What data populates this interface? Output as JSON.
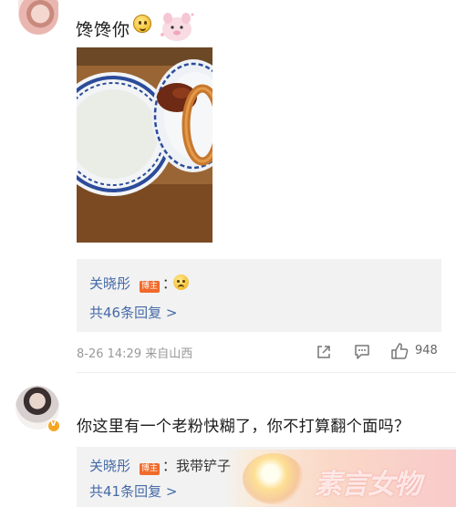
{
  "comment1": {
    "text": "馋馋你",
    "reply_preview": {
      "author": "关晓彤",
      "badge": "博主",
      "separator": "：",
      "emoji": "sad-face-emoji"
    },
    "reply_count_label": "共46条回复 >",
    "meta": "8-26 14:29 来自山西",
    "likes": "948"
  },
  "comment2": {
    "text": "你这里有一个老粉快糊了，你不打算翻个面吗？",
    "reply_preview": {
      "author": "关晓彤",
      "badge": "博主",
      "text": "：我带铲子"
    },
    "reply_count_label": "共41条回复 >"
  },
  "watermark": {
    "text": "素言女物"
  },
  "colors": {
    "link": "#456aa8",
    "meta": "#999999",
    "reply_bg": "#f2f2f2",
    "badge": "#f06a2a"
  }
}
